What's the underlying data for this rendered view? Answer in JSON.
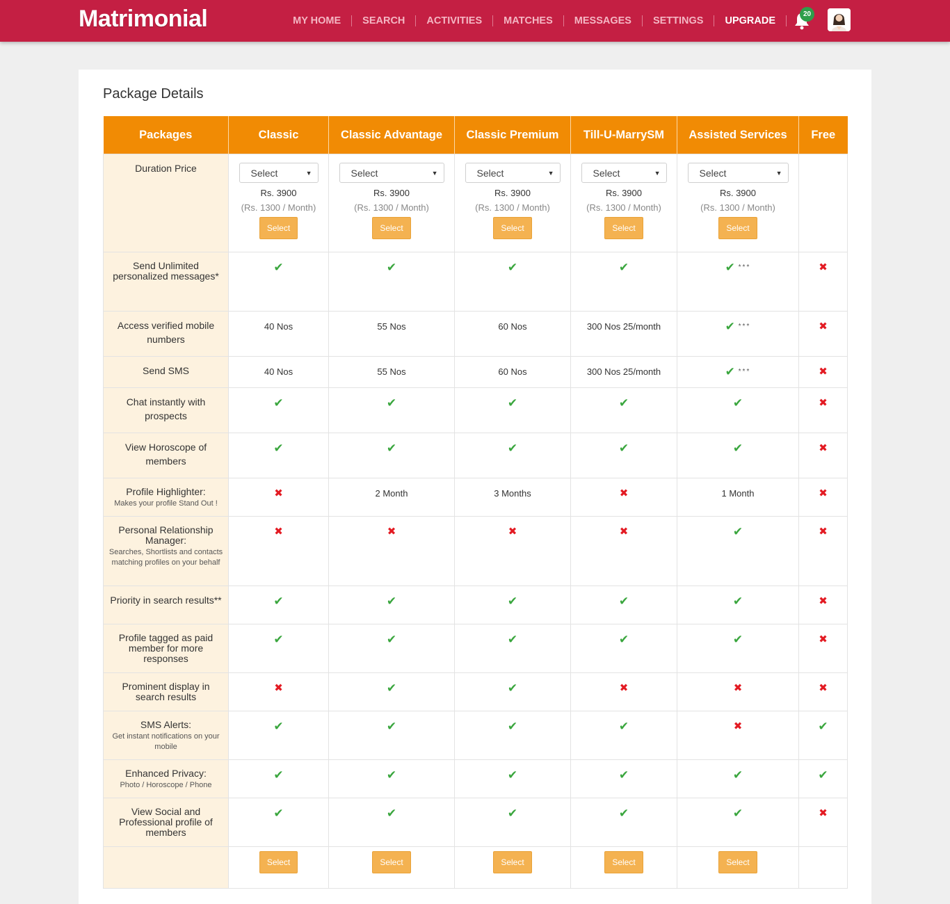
{
  "header": {
    "logo": "Matrimonial",
    "nav": [
      "MY HOME",
      "SEARCH",
      "ACTIVITIES",
      "MATCHES",
      "MESSAGES",
      "SETTINGS",
      "UPGRADE"
    ],
    "active_nav": "UPGRADE",
    "notifications": "20",
    "brand_color": "#c41f43"
  },
  "page": {
    "title": "Package Details"
  },
  "table": {
    "columns": [
      "Packages",
      "Classic",
      "Classic Advantage",
      "Classic Premium",
      "Till-U-MarrySM",
      "Assisted Services",
      "Free"
    ],
    "duration": {
      "label": "Duration Price",
      "select_placeholder": "Select",
      "price": "Rs. 3900",
      "per_month": "(Rs. 1300 / Month)",
      "button": "Select"
    },
    "rows": [
      {
        "label": "Send Unlimited personalized messages*",
        "sub": "",
        "cells": [
          "check",
          "check",
          "check",
          "check",
          "check***",
          "cross"
        ]
      },
      {
        "label": "Access verified mobile numbers",
        "sub": "",
        "cells": [
          "40 Nos",
          "55 Nos",
          "60 Nos",
          "300 Nos 25/month",
          "check***",
          "cross"
        ]
      },
      {
        "label": "Send SMS",
        "sub": "",
        "cells": [
          "40 Nos",
          "55 Nos",
          "60 Nos",
          "300 Nos 25/month",
          "check***",
          "cross"
        ]
      },
      {
        "label": "Chat instantly with prospects",
        "sub": "",
        "cells": [
          "check",
          "check",
          "check",
          "check",
          "check",
          "cross"
        ]
      },
      {
        "label": "View Horoscope of members",
        "sub": "",
        "cells": [
          "check",
          "check",
          "check",
          "check",
          "check",
          "cross"
        ]
      },
      {
        "label": "Profile Highlighter:",
        "sub": "Makes your profile Stand Out !",
        "cells": [
          "cross",
          "2 Month",
          "3 Months",
          "cross",
          "1 Month",
          "cross"
        ]
      },
      {
        "label": "Personal Relationship Manager:",
        "sub": "Searches, Shortlists and contacts matching profiles on your behalf",
        "cells": [
          "cross",
          "cross",
          "cross",
          "cross",
          "check",
          "cross"
        ]
      },
      {
        "label": "Priority in search results**",
        "sub": "",
        "cells": [
          "check",
          "check",
          "check",
          "check",
          "check",
          "cross"
        ]
      },
      {
        "label": "Profile tagged as paid member for more responses",
        "sub": "",
        "cells": [
          "check",
          "check",
          "check",
          "check",
          "check",
          "cross"
        ]
      },
      {
        "label": "Prominent display in search results",
        "sub": "",
        "cells": [
          "cross",
          "check",
          "check",
          "cross",
          "cross",
          "cross"
        ]
      },
      {
        "label": "SMS Alerts:",
        "sub": "Get instant notifications on your mobile",
        "cells": [
          "check",
          "check",
          "check",
          "check",
          "cross",
          "check"
        ]
      },
      {
        "label": "Enhanced Privacy:",
        "sub": "Photo / Horoscope / Phone",
        "cells": [
          "check",
          "check",
          "check",
          "check",
          "check",
          "check"
        ]
      },
      {
        "label": "View Social and Professional profile of members",
        "sub": "",
        "cells": [
          "check",
          "check",
          "check",
          "check",
          "check",
          "cross"
        ]
      }
    ],
    "footer_button": "Select",
    "colors": {
      "header": "#f18b04",
      "feature_bg": "#fdf2df",
      "check": "#3aa63e",
      "cross": "#e31b23",
      "button": "#f4b251"
    }
  }
}
